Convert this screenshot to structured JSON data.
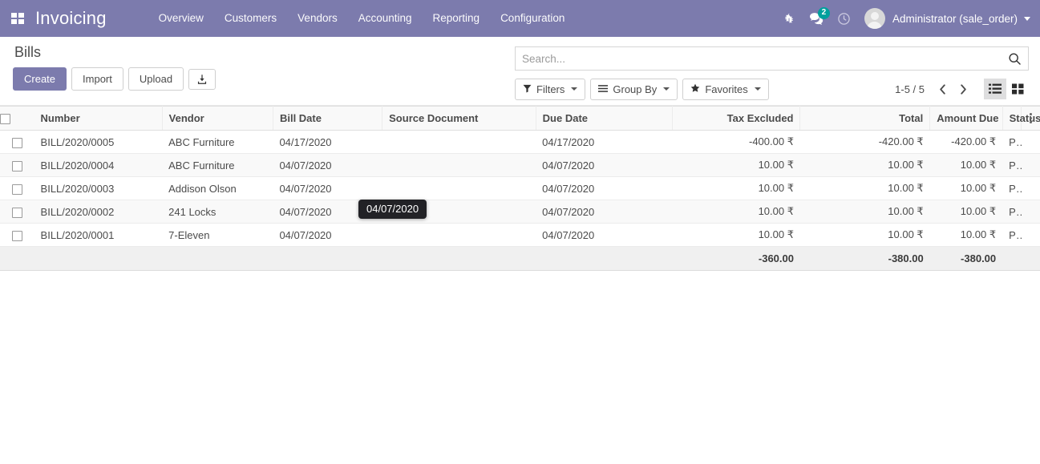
{
  "navbar": {
    "apps_icon": "apps-grid-icon",
    "brand": "Invoicing",
    "menu": [
      {
        "label": "Overview"
      },
      {
        "label": "Customers"
      },
      {
        "label": "Vendors"
      },
      {
        "label": "Accounting"
      },
      {
        "label": "Reporting"
      },
      {
        "label": "Configuration"
      }
    ],
    "icons": [
      {
        "name": "bug-icon"
      },
      {
        "name": "messages-icon",
        "badge": "2",
        "badge_color": "#00A09D"
      },
      {
        "name": "activity-clock-icon"
      }
    ],
    "user": {
      "name": "Administrator (sale_order)",
      "avatar": "user-avatar"
    },
    "background": "#7C7BAD"
  },
  "control_panel": {
    "title": "Bills",
    "buttons": {
      "create": "Create",
      "import": "Import",
      "upload": "Upload",
      "download_icon": "download-icon"
    },
    "search": {
      "placeholder": "Search...",
      "value": "",
      "search_icon": "search-icon"
    },
    "filters": [
      {
        "label": "Filters",
        "icon": "filter-funnel-icon"
      },
      {
        "label": "Group By",
        "icon": "group-by-lines-icon"
      },
      {
        "label": "Favorites",
        "icon": "star-icon"
      }
    ],
    "pager": {
      "range": "1-5 / 5",
      "prev_icon": "chevron-left-icon",
      "next_icon": "chevron-right-icon"
    },
    "views": [
      {
        "name": "list-view",
        "icon": "list-icon",
        "active": true
      },
      {
        "name": "kanban-view",
        "icon": "grid-icon",
        "active": false
      }
    ]
  },
  "table": {
    "columns": [
      {
        "label": "Number",
        "align": "left"
      },
      {
        "label": "Vendor",
        "align": "left"
      },
      {
        "label": "Bill Date",
        "align": "left"
      },
      {
        "label": "Source Document",
        "align": "left"
      },
      {
        "label": "Due Date",
        "align": "left"
      },
      {
        "label": "Tax Excluded",
        "align": "right"
      },
      {
        "label": "Total",
        "align": "right"
      },
      {
        "label": "Amount Due",
        "align": "right"
      },
      {
        "label": "Status",
        "align": "left"
      }
    ],
    "rows": [
      {
        "number": "BILL/2020/0005",
        "vendor": "ABC Furniture",
        "bill_date": "04/17/2020",
        "source_document": "",
        "due_date": "04/17/2020",
        "tax_excluded": "-400.00 ₹",
        "total": "-420.00 ₹",
        "amount_due": "-420.00 ₹",
        "status": "Posted"
      },
      {
        "number": "BILL/2020/0004",
        "vendor": "ABC Furniture",
        "bill_date": "04/07/2020",
        "source_document": "",
        "due_date": "04/07/2020",
        "tax_excluded": "10.00 ₹",
        "total": "10.00 ₹",
        "amount_due": "10.00 ₹",
        "status": "Posted"
      },
      {
        "number": "BILL/2020/0003",
        "vendor": "Addison Olson",
        "bill_date": "04/07/2020",
        "source_document": "",
        "due_date": "04/07/2020",
        "tax_excluded": "10.00 ₹",
        "total": "10.00 ₹",
        "amount_due": "10.00 ₹",
        "status": "Posted"
      },
      {
        "number": "BILL/2020/0002",
        "vendor": "241 Locks",
        "bill_date": "04/07/2020",
        "source_document": "",
        "due_date": "04/07/2020",
        "tax_excluded": "10.00 ₹",
        "total": "10.00 ₹",
        "amount_due": "10.00 ₹",
        "status": "Posted"
      },
      {
        "number": "BILL/2020/0001",
        "vendor": "7-Eleven",
        "bill_date": "04/07/2020",
        "source_document": "",
        "due_date": "04/07/2020",
        "tax_excluded": "10.00 ₹",
        "total": "10.00 ₹",
        "amount_due": "10.00 ₹",
        "status": "Posted"
      }
    ],
    "totals": {
      "tax_excluded": "-360.00",
      "total": "-380.00",
      "amount_due": "-380.00"
    },
    "optional_columns_icon": "vertical-dots-icon"
  },
  "tooltip": {
    "text": "04/07/2020"
  }
}
